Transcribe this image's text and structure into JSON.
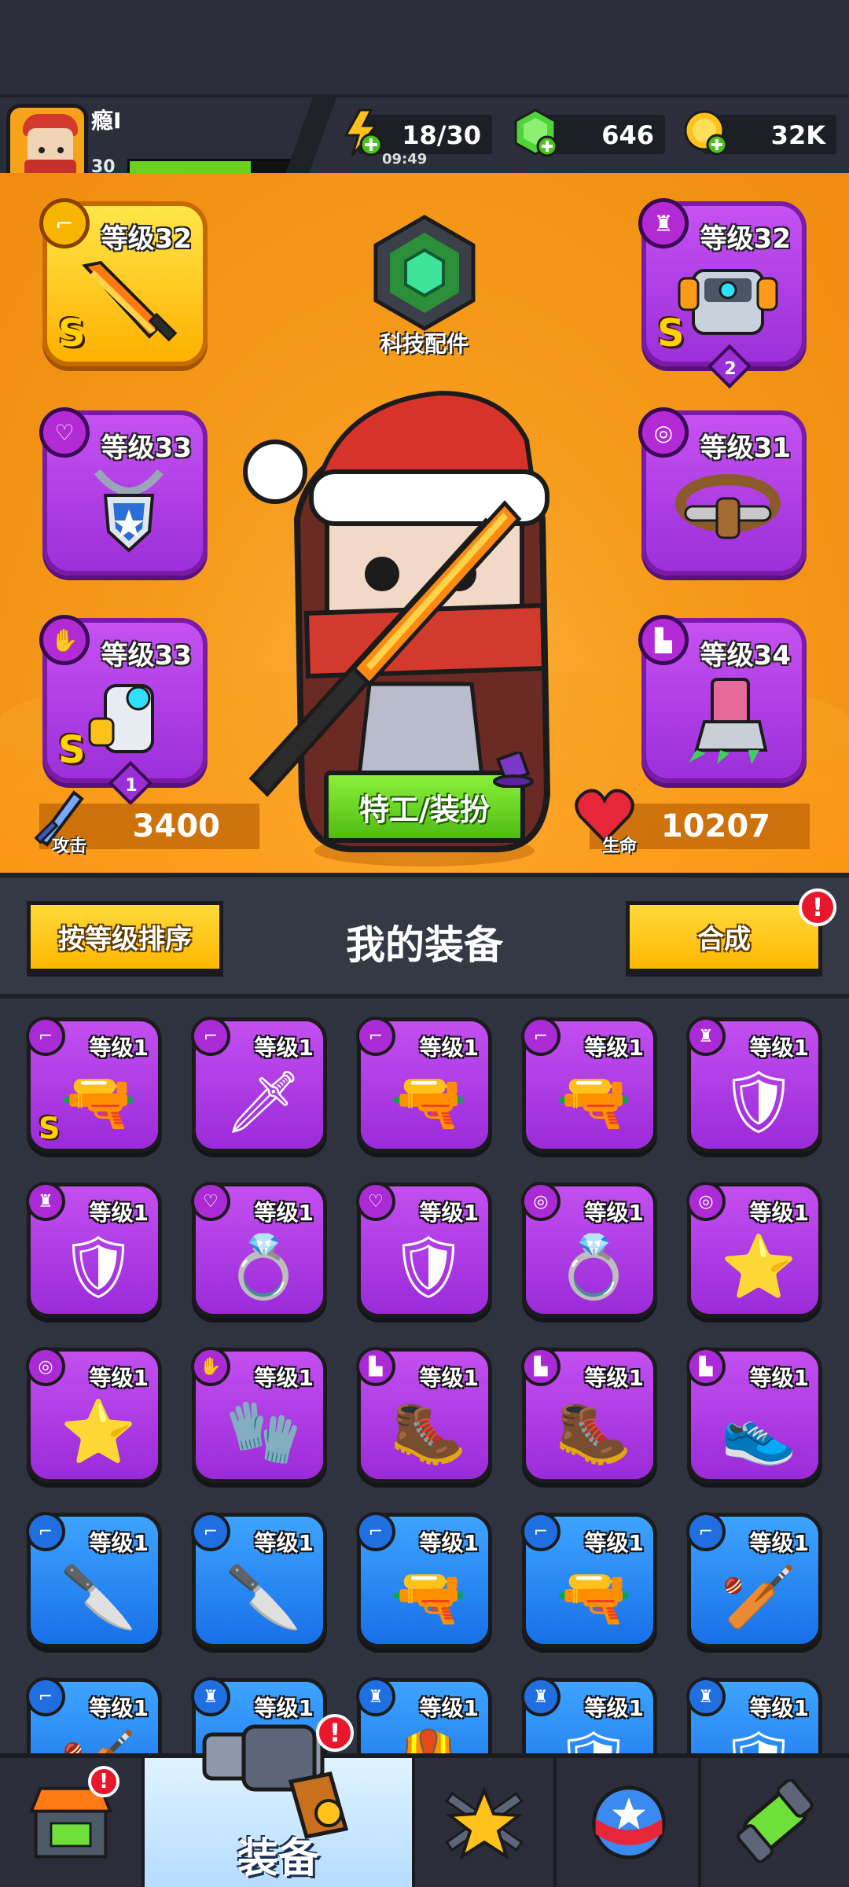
{
  "player": {
    "name": "瘾I",
    "level": "30",
    "xp_fraction": 0.72
  },
  "resources": {
    "energy": {
      "value": "18/30",
      "timer": "09:49",
      "icon": "lightning-plus-icon"
    },
    "gems": {
      "value": "646",
      "icon": "green-gem-plus-icon"
    },
    "coins": {
      "value": "32K",
      "icon": "gold-coin-plus-icon"
    }
  },
  "tech_parts": {
    "label": "科技配件"
  },
  "equipped": {
    "weapon": {
      "level": "等级32",
      "rarity_mark": "S",
      "slot_icon": "gun-icon"
    },
    "armor": {
      "level": "等级32",
      "rarity_mark": "S",
      "stars": "2",
      "slot_icon": "shirt-icon"
    },
    "necklace": {
      "level": "等级33",
      "slot_icon": "necklace-icon"
    },
    "belt": {
      "level": "等级31",
      "slot_icon": "belt-icon"
    },
    "gloves": {
      "level": "等级33",
      "rarity_mark": "S",
      "stars": "1",
      "slot_icon": "glove-icon"
    },
    "boots": {
      "level": "等级34",
      "slot_icon": "boot-icon"
    }
  },
  "stats": {
    "attack_label": "攻击",
    "attack_value": "3400",
    "hp_label": "生命",
    "hp_value": "10207"
  },
  "outfit_button": "特工/装扮",
  "inventory": {
    "sort_button": "按等级排序",
    "title": "我的装备",
    "merge_button": "合成",
    "items": [
      {
        "level": "等级1",
        "color": "purple",
        "slot": "gun",
        "art": "plasma-gun",
        "s": "S"
      },
      {
        "level": "等级1",
        "color": "purple",
        "slot": "gun",
        "art": "kunai",
        "s": ""
      },
      {
        "level": "等级1",
        "color": "purple",
        "slot": "gun",
        "art": "revolver",
        "s": ""
      },
      {
        "level": "等级1",
        "color": "purple",
        "slot": "gun",
        "art": "shotgun",
        "s": ""
      },
      {
        "level": "等级1",
        "color": "purple",
        "slot": "shirt",
        "art": "leaf-armor",
        "s": ""
      },
      {
        "level": "等级1",
        "color": "purple",
        "slot": "shirt",
        "art": "stone-armor",
        "s": ""
      },
      {
        "level": "等级1",
        "color": "purple",
        "slot": "necklace",
        "art": "gem-necklace",
        "s": ""
      },
      {
        "level": "等级1",
        "color": "purple",
        "slot": "necklace",
        "art": "shield-necklace",
        "s": ""
      },
      {
        "level": "等级1",
        "color": "purple",
        "slot": "belt",
        "art": "gem-belt",
        "s": ""
      },
      {
        "level": "等级1",
        "color": "purple",
        "slot": "belt",
        "art": "star-belt",
        "s": ""
      },
      {
        "level": "等级1",
        "color": "purple",
        "slot": "belt",
        "art": "star-belt",
        "s": ""
      },
      {
        "level": "等级1",
        "color": "purple",
        "slot": "glove",
        "art": "gauntlet",
        "s": ""
      },
      {
        "level": "等级1",
        "color": "purple",
        "slot": "boot",
        "art": "claw-boot",
        "s": ""
      },
      {
        "level": "等级1",
        "color": "purple",
        "slot": "boot",
        "art": "combat-boot",
        "s": ""
      },
      {
        "level": "等级1",
        "color": "purple",
        "slot": "boot",
        "art": "tech-boot",
        "s": ""
      },
      {
        "level": "等级1",
        "color": "blue",
        "slot": "gun",
        "art": "machete",
        "s": ""
      },
      {
        "level": "等级1",
        "color": "blue",
        "slot": "gun",
        "art": "machete",
        "s": ""
      },
      {
        "level": "等级1",
        "color": "blue",
        "slot": "gun",
        "art": "revolver",
        "s": ""
      },
      {
        "level": "等级1",
        "color": "blue",
        "slot": "gun",
        "art": "shotgun",
        "s": ""
      },
      {
        "level": "等级1",
        "color": "blue",
        "slot": "gun",
        "art": "bat",
        "s": ""
      },
      {
        "level": "等级1",
        "color": "blue",
        "slot": "gun",
        "art": "bat",
        "s": ""
      },
      {
        "level": "等级1",
        "color": "blue",
        "slot": "shirt",
        "art": "vest",
        "s": ""
      },
      {
        "level": "等级1",
        "color": "blue",
        "slot": "shirt",
        "art": "vest",
        "s": ""
      },
      {
        "level": "等级1",
        "color": "blue",
        "slot": "shirt",
        "art": "armor",
        "s": ""
      },
      {
        "level": "等级1",
        "color": "blue",
        "slot": "shirt",
        "art": "armor",
        "s": ""
      }
    ]
  },
  "nav": {
    "shop": {
      "icon": "shop-icon"
    },
    "equipment": {
      "label": "装备",
      "icon": "revolver-icon"
    },
    "battle": {
      "icon": "crossed-swords-star-icon"
    },
    "talents": {
      "icon": "star-ball-icon"
    },
    "evolve": {
      "icon": "dna-capsule-icon"
    }
  },
  "colors": {
    "accent_orange": "#f69b1b",
    "purple_item": "#b33ee6",
    "blue_item": "#2a8af5",
    "alert_red": "#e8172c",
    "button_yellow": "#ffc81a",
    "button_green": "#5fcc1e"
  }
}
